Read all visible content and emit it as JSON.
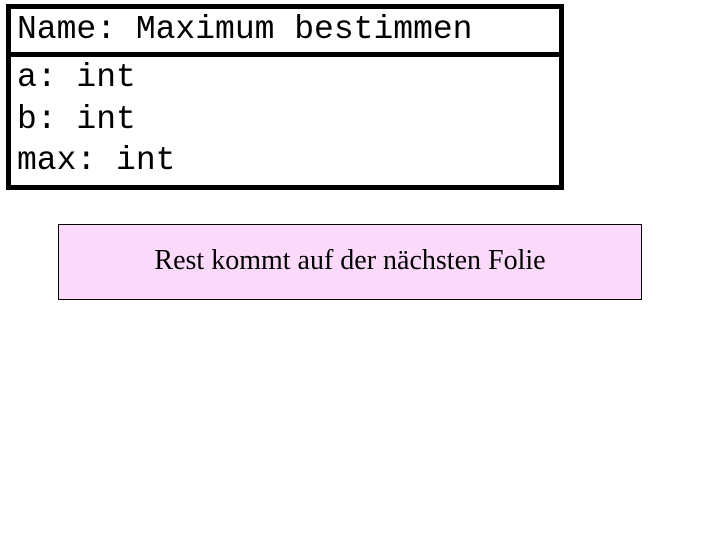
{
  "header": {
    "label_prefix": "Name: ",
    "name": "Maximum bestimmen"
  },
  "vars": [
    {
      "name": "a",
      "type": "int"
    },
    {
      "name": "b",
      "type": "int"
    },
    {
      "name": "max",
      "type": "int"
    }
  ],
  "caption": "Rest kommt auf der nächsten Folie"
}
